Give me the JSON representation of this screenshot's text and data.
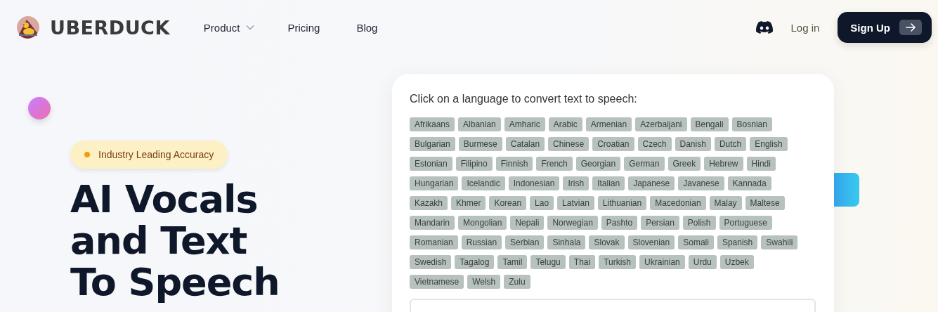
{
  "header": {
    "brand": "UBERDUCK",
    "nav": [
      {
        "label": "Product",
        "has_menu": true
      },
      {
        "label": "Pricing",
        "has_menu": false
      },
      {
        "label": "Blog",
        "has_menu": false
      }
    ],
    "login": "Log in",
    "signup": "Sign Up"
  },
  "hero": {
    "badge": "Industry Leading Accuracy",
    "heading": [
      "AI Vocals",
      "and Text",
      "To Speech"
    ]
  },
  "language_card": {
    "prompt": "Click on a language to convert text to speech:",
    "language_rows": [
      [
        "Afrikaans",
        "Albanian",
        "Amharic",
        "Arabic",
        "Armenian",
        "Azerbaijani",
        "Bengali",
        "Bosnian"
      ],
      [
        "Bulgarian",
        "Burmese",
        "Catalan",
        "Chinese",
        "Croatian",
        "Czech",
        "Danish",
        "Dutch",
        "English"
      ],
      [
        "Estonian",
        "Filipino",
        "Finnish",
        "French",
        "Georgian",
        "German",
        "Greek",
        "Hebrew",
        "Hindi"
      ],
      [
        "Hungarian",
        "Icelandic",
        "Indonesian",
        "Irish",
        "Italian",
        "Japanese",
        "Javanese",
        "Kannada"
      ],
      [
        "Kazakh",
        "Khmer",
        "Korean",
        "Lao",
        "Latvian",
        "Lithuanian",
        "Macedonian",
        "Malay",
        "Maltese"
      ],
      [
        "Mandarin",
        "Mongolian",
        "Nepali",
        "Norwegian",
        "Pashto",
        "Persian",
        "Polish",
        "Portuguese"
      ],
      [
        "Romanian",
        "Russian",
        "Serbian",
        "Sinhala",
        "Slovak",
        "Slovenian",
        "Somali",
        "Spanish",
        "Swahili"
      ],
      [
        "Swedish",
        "Tagalog",
        "Tamil",
        "Telugu",
        "Thai",
        "Turkish",
        "Ukrainian",
        "Urdu",
        "Uzbek"
      ],
      [
        "Vietnamese",
        "Welsh",
        "Zulu"
      ]
    ]
  }
}
